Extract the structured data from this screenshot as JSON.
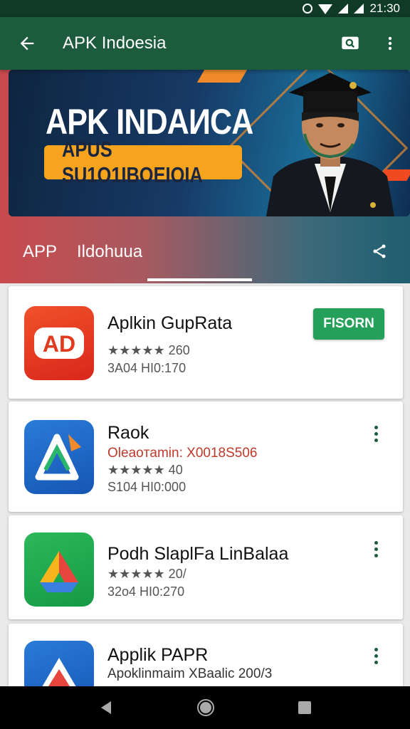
{
  "status_bar": {
    "time": "21:30"
  },
  "app_bar": {
    "title": "APK Indoesia"
  },
  "banner": {
    "headline": "APK INDAИCA",
    "subline": "APUS SU1O1IBOEIOIA"
  },
  "tabs": [
    {
      "label": "APP"
    },
    {
      "label": "Ildohuua"
    }
  ],
  "apps": [
    {
      "name": "Aplkin GupRata",
      "sub": "",
      "rating": "★★★★★ 260",
      "size": "3A04 HI0:170",
      "action": "FISORN",
      "icon": "red-app-icon"
    },
    {
      "name": "Raok",
      "sub": "Oleaoтamin: X0018S506",
      "rating": "★★★★★ 40",
      "size": "S104 HI0:000",
      "action": "more",
      "icon": "blue-app-icon"
    },
    {
      "name": "Podh SlaplFa LinBalaa",
      "sub": "",
      "rating": "★★★★★ 20/",
      "size": "32o4 HI0:270",
      "action": "more",
      "icon": "green-drive-icon"
    },
    {
      "name": "Applik PAPR",
      "sub": "Apoklinmaim XBaalic 200/3",
      "rating": "",
      "size": "",
      "action": "more",
      "icon": "blue-drive-icon"
    }
  ],
  "colors": {
    "app_bar": "#1d5b3d",
    "status_bar": "#0f3a26",
    "install": "#25a05a",
    "sub_red": "#c0392b"
  }
}
